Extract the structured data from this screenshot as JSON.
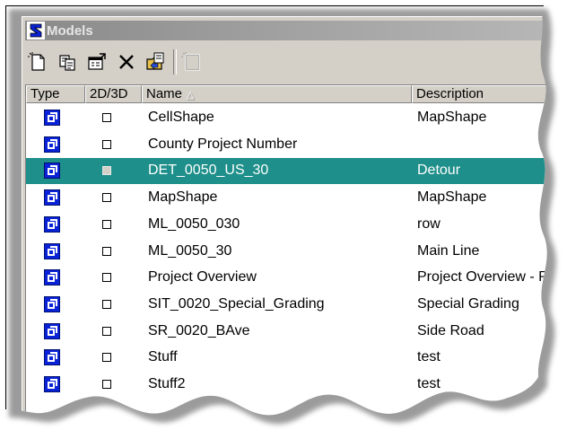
{
  "window": {
    "title": "Models"
  },
  "toolbar": {
    "buttons": [
      {
        "name": "new-model-button",
        "icon": "new-document-icon"
      },
      {
        "name": "copy-model-button",
        "icon": "copy-icon"
      },
      {
        "name": "properties-button",
        "icon": "properties-icon"
      },
      {
        "name": "delete-button",
        "icon": "delete-x-icon"
      },
      {
        "name": "import-button",
        "icon": "folder-import-icon"
      },
      {
        "name": "create-sheet-button",
        "icon": "sheet-icon",
        "disabled": true
      }
    ]
  },
  "list": {
    "columns": [
      "Type",
      "2D/3D",
      "Name",
      "Description"
    ],
    "sort_indicator": "△",
    "rows": [
      {
        "name": "CellShape",
        "description": "MapShape",
        "selected": false
      },
      {
        "name": "County Project Number",
        "description": "",
        "selected": false
      },
      {
        "name": "DET_0050_US_30",
        "description": "Detour",
        "selected": true
      },
      {
        "name": "MapShape",
        "description": "MapShape",
        "selected": false
      },
      {
        "name": "ML_0050_030",
        "description": "row",
        "selected": false
      },
      {
        "name": "ML_0050_30",
        "description": "Main Line",
        "selected": false
      },
      {
        "name": "Project Overview",
        "description": "Project Overview - P",
        "selected": false
      },
      {
        "name": "SIT_0020_Special_Grading",
        "description": "Special Grading",
        "selected": false
      },
      {
        "name": "SR_0020_BAve",
        "description": "Side Road",
        "selected": false
      },
      {
        "name": "Stuff",
        "description": "test",
        "selected": false
      },
      {
        "name": "Stuff2",
        "description": "test",
        "selected": false
      }
    ]
  },
  "colors": {
    "selection": "#1e8f8a",
    "model_icon": "#0a22d6",
    "titlebar": "#9e9e9e"
  }
}
